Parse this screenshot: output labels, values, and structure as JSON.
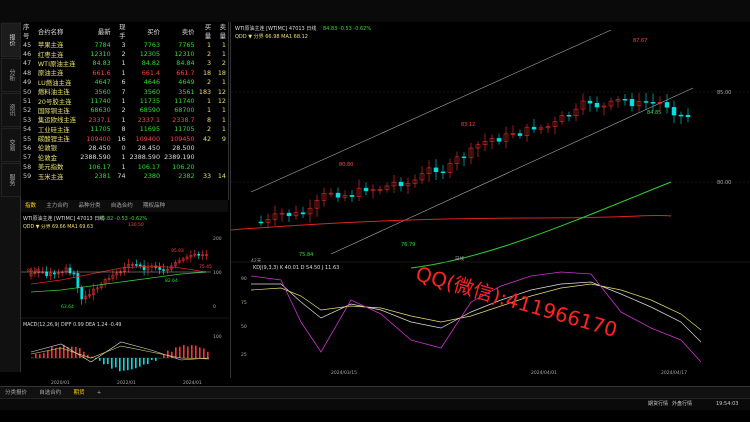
{
  "sidebar_tabs": [
    "报价",
    "分析",
    "资讯",
    "交易",
    "服务"
  ],
  "list": {
    "headers": [
      "序号",
      "合约名称",
      "最新",
      "现手",
      "买价",
      "卖价",
      "买量",
      "卖量"
    ],
    "rows": [
      {
        "no": "45",
        "name": "苹果主连",
        "last": "7784",
        "vol": "3",
        "bid": "7763",
        "ask": "7765",
        "bq": "1",
        "aq": "1",
        "c": "dn"
      },
      {
        "no": "46",
        "name": "红枣主连",
        "last": "12310",
        "vol": "2",
        "bid": "12305",
        "ask": "12310",
        "bq": "2",
        "aq": "1",
        "c": "dn"
      },
      {
        "no": "47",
        "name": "WTI原油主连",
        "last": "84.83",
        "vol": "1",
        "bid": "84.82",
        "ask": "84.84",
        "bq": "3",
        "aq": "2",
        "c": "dn"
      },
      {
        "no": "48",
        "name": "原油主连",
        "last": "661.6",
        "vol": "1",
        "bid": "661.4",
        "ask": "661.7",
        "bq": "18",
        "aq": "18",
        "c": "up"
      },
      {
        "no": "49",
        "name": "LU燃油主连",
        "last": "4647",
        "vol": "6",
        "bid": "4646",
        "ask": "4649",
        "bq": "2",
        "aq": "1",
        "c": "dn"
      },
      {
        "no": "50",
        "name": "燃料油主连",
        "last": "3560",
        "vol": "7",
        "bid": "3560",
        "ask": "3561",
        "bq": "183",
        "aq": "12",
        "c": "dn"
      },
      {
        "no": "51",
        "name": "20号胶主连",
        "last": "11740",
        "vol": "1",
        "bid": "11735",
        "ask": "11740",
        "bq": "1",
        "aq": "12",
        "c": "dn"
      },
      {
        "no": "52",
        "name": "国际铜主连",
        "last": "68630",
        "vol": "2",
        "bid": "68590",
        "ask": "68700",
        "bq": "1",
        "aq": "1",
        "c": "dn"
      },
      {
        "no": "53",
        "name": "集运欧线主连",
        "last": "2337.1",
        "vol": "1",
        "bid": "2337.1",
        "ask": "2338.7",
        "bq": "8",
        "aq": "1",
        "c": "up"
      },
      {
        "no": "54",
        "name": "工业硅主连",
        "last": "11705",
        "vol": "8",
        "bid": "11695",
        "ask": "11705",
        "bq": "2",
        "aq": "1",
        "c": "dn"
      },
      {
        "no": "55",
        "name": "碳酸锂主连",
        "last": "109400",
        "vol": "16",
        "bid": "109400",
        "ask": "109450",
        "bq": "42",
        "aq": "9",
        "c": "up"
      },
      {
        "no": "56",
        "name": "伦敦银",
        "last": "28.450",
        "vol": "0",
        "bid": "28.450",
        "ask": "28.500",
        "bq": "",
        "aq": "",
        "c": "wh"
      },
      {
        "no": "57",
        "name": "伦敦金",
        "last": "2388.590",
        "vol": "1",
        "bid": "2388.590",
        "ask": "2389.190",
        "bq": "",
        "aq": "",
        "c": "wh"
      },
      {
        "no": "58",
        "name": "美元指数",
        "last": "106.17",
        "vol": "1",
        "bid": "106.17",
        "ask": "106.20",
        "bq": "",
        "aq": "",
        "c": "dn"
      },
      {
        "no": "59",
        "name": "玉米主连",
        "last": "2381",
        "vol": "74",
        "bid": "2380",
        "ask": "2382",
        "bq": "33",
        "aq": "14",
        "c": "dn"
      }
    ]
  },
  "small_tabs": [
    "指数",
    "主力合约",
    "品种分类",
    "自选合约",
    "期权品种"
  ],
  "small_chart": {
    "header": "WTI原油主连 [WTIMC] 47013  日线",
    "price_text": "85.82  -0.53  -0.62%",
    "ma_label": "QDD ▼  分界 69.66  MA1 69.63",
    "labels": {
      "high": "130.50",
      "mid": "95.03",
      "ma": "82.64",
      "low": "63.64",
      "left": "86.80",
      "right": "75.45"
    },
    "macd_label": "MACD(12,26,9)  DIFF 0.99  DEA 1.24  -0.49",
    "xticks": [
      "2020/01",
      "2022/01",
      "2024/01"
    ],
    "ytick": "100",
    "side_ticks": [
      "200",
      "100",
      "0"
    ]
  },
  "main_chart": {
    "header": "WTI原油主连 [WTIMC] 47013  日线",
    "price_text": "84.83  -0.53  -0.62%",
    "ma_label": "QDD ▼  分界 66.98  MA1 68.12",
    "price_labels": {
      "top": "87.67",
      "p1": "83.12",
      "p2": "80.80",
      "p3": "75.84",
      "p4": "76.79",
      "p5": "84.85"
    },
    "yticks": [
      "85.00",
      "80.00"
    ],
    "kdj_label": "KDJ(9,3,3)  K 40.01  D 54.50  J 11.63",
    "kdj_ticks": [
      "90",
      "75",
      "50",
      "25"
    ],
    "xticks": [
      "2024/03/15",
      "2024/04/01",
      "2024/04/17"
    ],
    "corner_label": "日线",
    "legend_note": "42天"
  },
  "watermark": "QQ(微信):411966170",
  "bottom_tabs": [
    "分类报价",
    "自选合约",
    "期货",
    "+"
  ],
  "status": {
    "left": "期货行情",
    "mid": "外盘行情",
    "time": "19:54:03"
  }
}
